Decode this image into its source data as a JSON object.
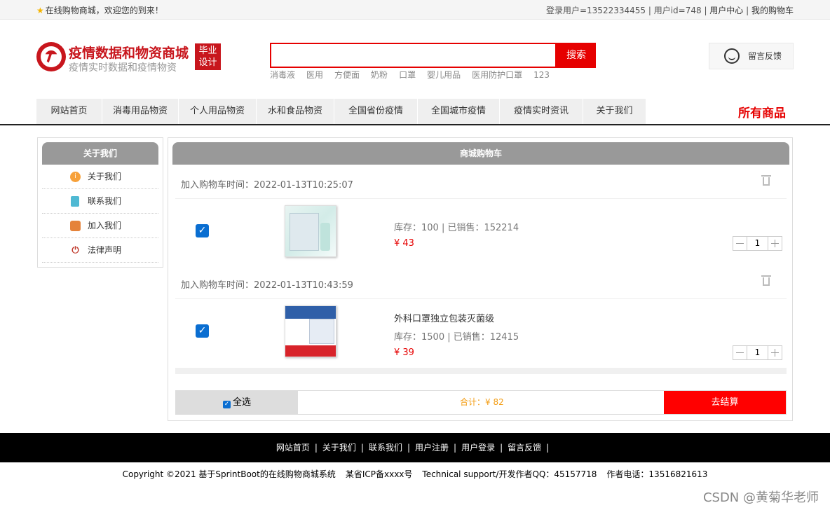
{
  "topbar": {
    "welcome": "在线购物商城，欢迎您的到来！",
    "login_user": "登录用户=13522334455",
    "user_id": "用户id=748",
    "user_center": "用户中心",
    "my_cart": "我的购物车"
  },
  "header": {
    "title": "疫情数据和物资商城",
    "subtitle": "疫情实时数据和疫情物资",
    "badge": "毕业设计",
    "search_placeholder": "",
    "search_label": "搜索",
    "hot_words": [
      "消毒液",
      "医用",
      "方便面",
      "奶粉",
      "口罩",
      "婴儿用品",
      "医用防护口罩",
      "123"
    ],
    "feedback_label": "留言反馈"
  },
  "nav": {
    "items": [
      "网站首页",
      "消毒用品物资",
      "个人用品物资",
      "水和食品物资",
      "全国省份疫情",
      "全国城市疫情",
      "疫情实时资讯",
      "关于我们"
    ],
    "all_products": "所有商品"
  },
  "side": {
    "title": "关于我们",
    "items": [
      {
        "label": "关于我们",
        "icon": "info-icon",
        "color": "#f7a13a"
      },
      {
        "label": "联系我们",
        "icon": "document-icon",
        "color": "#4fb9d3"
      },
      {
        "label": "加入我们",
        "icon": "lock-icon",
        "color": "#e5833a"
      },
      {
        "label": "法律声明",
        "icon": "power-icon",
        "color": "#c0392b"
      }
    ]
  },
  "cart": {
    "title": "商城购物车",
    "items": [
      {
        "added_time": "加入购物车时间：2022-01-13T10:25:07",
        "name": "",
        "stock_sales": "库存：100 | 已销售：152214",
        "price": "¥ 43",
        "qty": "1",
        "checked": true
      },
      {
        "added_time": "加入购物车时间：2022-01-13T10:43:59",
        "name": "外科口罩独立包装灭菌级",
        "stock_sales": "库存：1500 | 已销售：12415",
        "price": "¥ 39",
        "qty": "1",
        "checked": true
      }
    ],
    "select_all": "全选",
    "total": "合计：¥ 82",
    "checkout": "去结算"
  },
  "footer": {
    "links": [
      "网站首页",
      "关于我们",
      "联系我们",
      "用户注册",
      "用户登录",
      "留言反馈"
    ],
    "copyright": "Copyright ©2021 基于SprintBoot的在线购物商城系统",
    "icp": "某省ICP备xxxx号",
    "support": "Technical support/开发作者QQ：45157718",
    "phone": "作者电话：13516821613"
  },
  "watermark": "CSDN @黄菊华老师",
  "colors": {
    "brand": "#c8161d",
    "accent": "#e60000",
    "checkbox": "#0a6ed1",
    "total": "#f39c12"
  }
}
